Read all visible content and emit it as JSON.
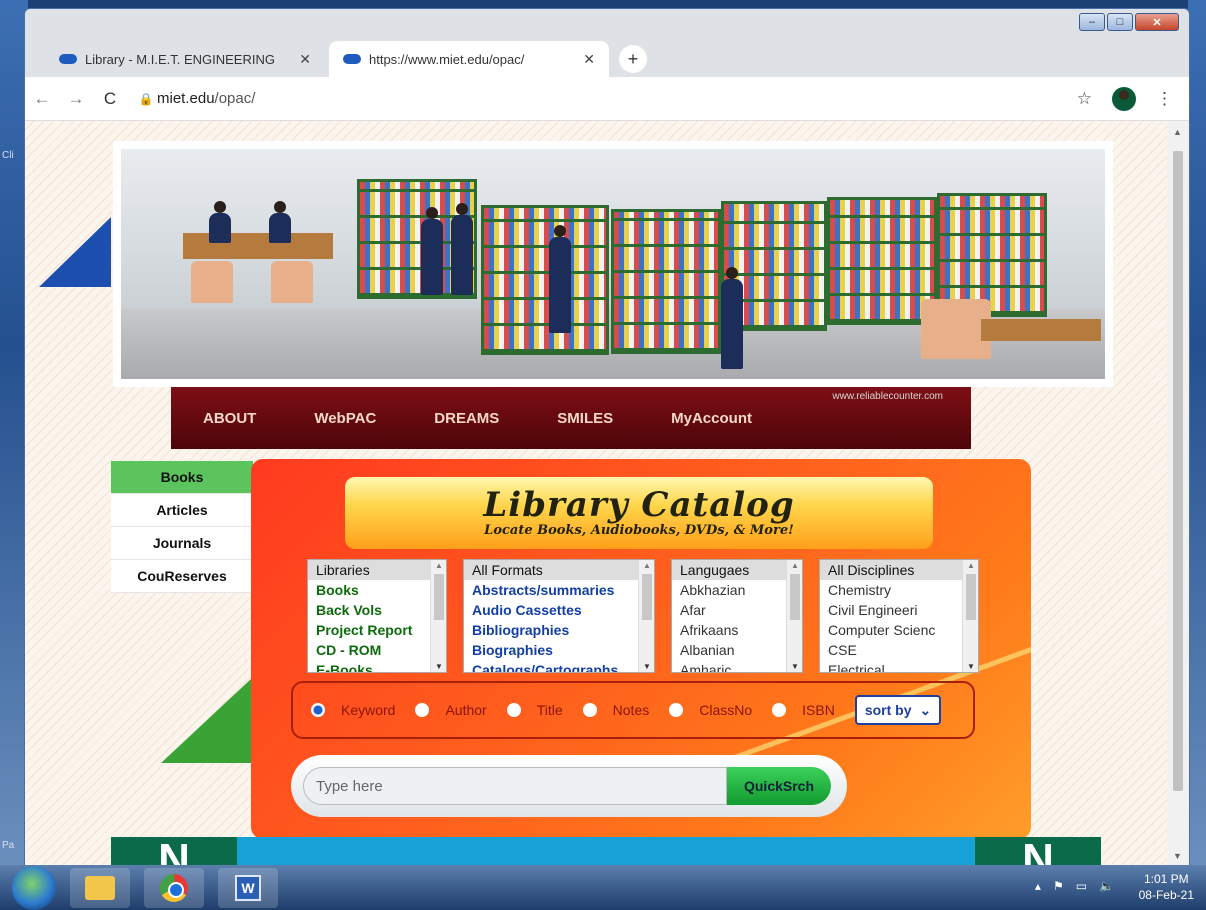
{
  "desktop": {
    "left_label": "Cli",
    "bottom_left_label": "Pa"
  },
  "window_controls": {
    "minimize": "–",
    "maximize": "□",
    "close": "✕"
  },
  "tabs": [
    {
      "title": "Library - M.I.E.T. ENGINEERING",
      "close": "✕"
    },
    {
      "title": "https://www.miet.edu/opac/",
      "close": "✕"
    }
  ],
  "new_tab": "+",
  "toolbar": {
    "back": "←",
    "forward": "→",
    "reload": "C",
    "url_host": "miet.edu",
    "url_path": "/opac/"
  },
  "site": {
    "counter_text": "www.reliablecounter.com",
    "nav": [
      "ABOUT",
      "WebPAC",
      "DREAMS",
      "SMILES",
      "MyAccount"
    ],
    "sidebar": [
      "Books",
      "Articles",
      "Journals",
      "CouReserves"
    ],
    "catalog": {
      "title": "Library Catalog",
      "subtitle": "Locate Books, Audiobooks, DVDs, & More!"
    },
    "lists": {
      "libraries": [
        "Libraries",
        "Books",
        "Back Vols",
        "Project Report",
        "CD - ROM",
        "E-Books"
      ],
      "formats": [
        "All Formats",
        "Abstracts/summaries",
        "Audio Cassettes",
        "Bibliographies",
        "Biographies",
        "Catalogs/Cartographs"
      ],
      "languages": [
        "Langugaes",
        "Abkhazian",
        "Afar",
        "Afrikaans",
        "Albanian",
        "Amharic"
      ],
      "disciplines": [
        "All Disciplines",
        "Chemistry",
        "Civil Engineeri",
        "Computer Scienc",
        "CSE",
        "Electrical"
      ]
    },
    "search_by": [
      "Keyword",
      "Author",
      "Title",
      "Notes",
      "ClassNo",
      "ISBN"
    ],
    "sort_label": "sort by",
    "search_placeholder": "Type here",
    "quick_button": "QuickSrch",
    "footer_tile_text": "N"
  },
  "taskbar": {
    "tray_icons": [
      "▴",
      "⚑",
      "▭",
      "🔈"
    ],
    "time": "1:01 PM",
    "date": "08-Feb-21"
  },
  "colors": {
    "nav_bg": "#6b0a10",
    "panel_orange": "#ff5a1e",
    "sidebar_active": "#5cc45c",
    "quick_button": "#1fb33f"
  }
}
